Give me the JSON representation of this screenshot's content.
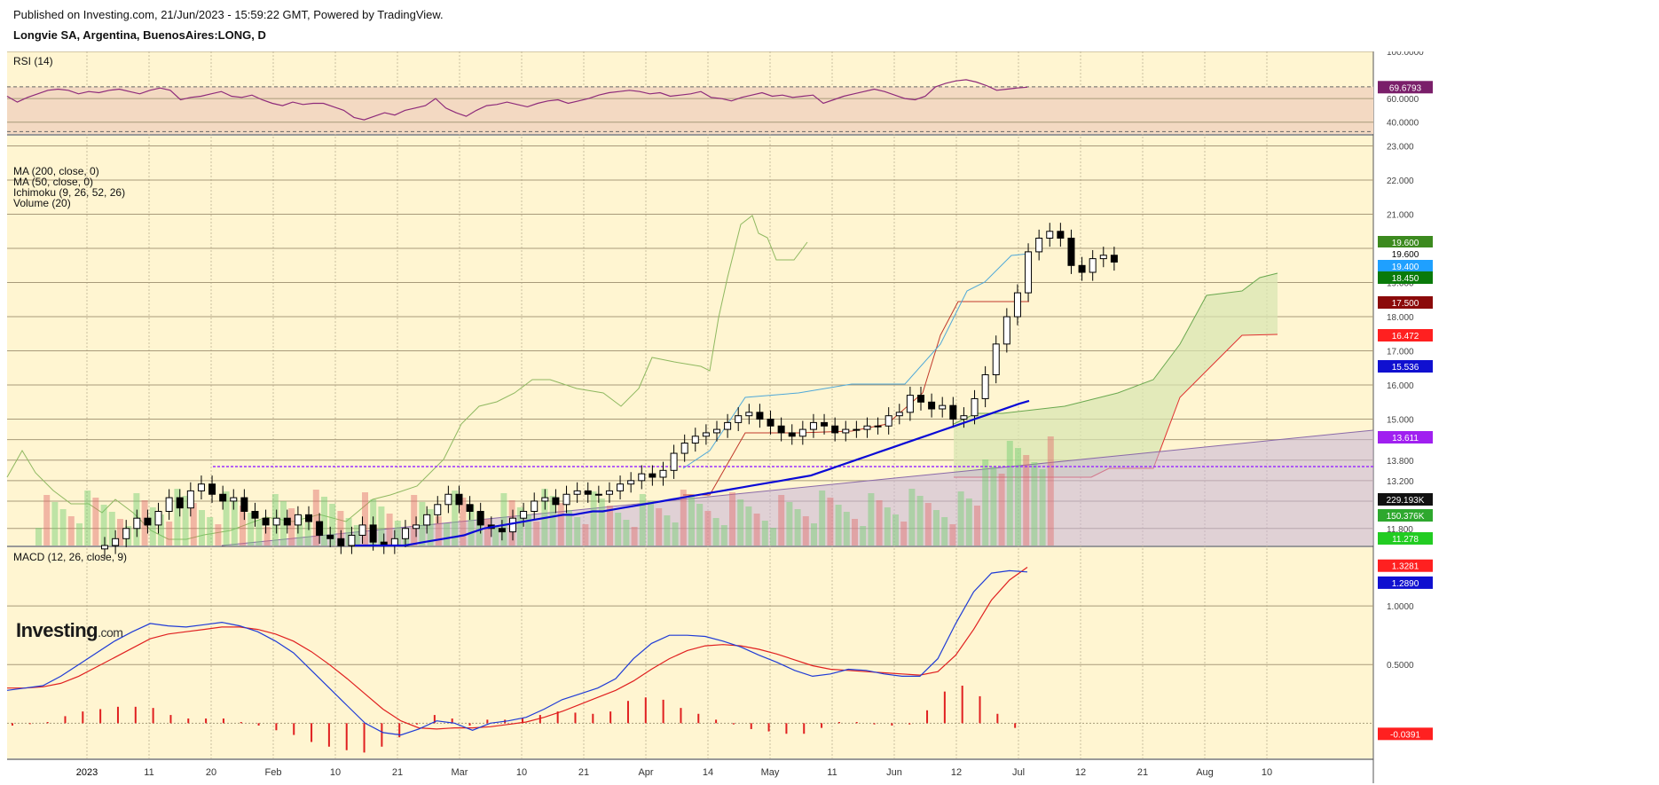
{
  "header": {
    "published": "Published on Investing.com, 21/Jun/2023 - 15:59:22 GMT, Powered by TradingView.",
    "symbol": "Longvie SA, Argentina, BuenosAires:LONG, D"
  },
  "logo": {
    "main": "Investing",
    "suffix": ".com"
  },
  "colors": {
    "background": "#fff5d1",
    "rsi_band": "#f3d9c2",
    "rsi_line": "#8e2b7a",
    "ma200": "#0a0ad6",
    "ma50": "#c0392b",
    "kumo_green": "#6aa84f",
    "kumo_red": "#e03030",
    "macd_line": "#1f3bd6",
    "signal_line": "#e02020",
    "hist": "#e02020",
    "trend": "#9b30ff"
  },
  "chart_data": [
    {
      "type": "line",
      "panel": "rsi",
      "title": "RSI (14)",
      "ylim": [
        30,
        100
      ],
      "yticks": [
        40,
        60,
        100
      ],
      "ytick_labels": [
        "40.0000",
        "60.0000",
        "100.0000"
      ],
      "band": [
        30,
        70
      ],
      "series": [
        {
          "last_label": "69.6793",
          "values": [
            62,
            57,
            61,
            64,
            67,
            68,
            67,
            64,
            66,
            65,
            67,
            68,
            66,
            64,
            67,
            69,
            67,
            59,
            61,
            62,
            64,
            66,
            62,
            61,
            63,
            59,
            56,
            54,
            57,
            55,
            56,
            56,
            53,
            50,
            44,
            42,
            45,
            48,
            46,
            50,
            52,
            54,
            60,
            52,
            48,
            45,
            50,
            54,
            55,
            57,
            55,
            53,
            56,
            58,
            59,
            56,
            58,
            60,
            63,
            65,
            66,
            67,
            66,
            64,
            65,
            62,
            63,
            64,
            66,
            61,
            60,
            58,
            61,
            63,
            65,
            62,
            63,
            61,
            62,
            63,
            56,
            59,
            62,
            64,
            66,
            68,
            66,
            63,
            60,
            59,
            62,
            70,
            73,
            75,
            76,
            74,
            71,
            67,
            68,
            69,
            69.68
          ]
        }
      ]
    },
    {
      "type": "candlestick",
      "panel": "price",
      "legend": [
        "MA (200, close, 0)",
        "MA (50, close, 0)",
        "Ichimoku (9, 26, 52, 26)",
        "Volume (20)"
      ],
      "ylim": [
        11.3,
        23.3
      ],
      "yticks": [
        11.8,
        12.6,
        13.2,
        13.8,
        14.4,
        15.0,
        16.0,
        17.0,
        18.0,
        19.0,
        20.0,
        21.0,
        22.0,
        23.0
      ],
      "ytick_labels": [
        "11.800",
        "12.600",
        "13.200",
        "13.800",
        "14.400",
        "15.000",
        "16.000",
        "17.000",
        "18.000",
        "19.000",
        "20.000",
        "21.000",
        "22.000",
        "23.000"
      ],
      "x_labels": [
        "2023",
        "11",
        "20",
        "Feb",
        "10",
        "21",
        "Mar",
        "10",
        "21",
        "Apr",
        "14",
        "May",
        "11",
        "Jun",
        "12",
        "Jul",
        "12",
        "21",
        "Aug",
        "10"
      ],
      "x_label_index": [
        0,
        10,
        20,
        30,
        40,
        50,
        60,
        70,
        80,
        90,
        100,
        110,
        120,
        130,
        140,
        150,
        160,
        170,
        180,
        190
      ],
      "close": [
        11.3,
        11.5,
        11.8,
        12.1,
        11.9,
        12.3,
        12.7,
        12.4,
        12.9,
        13.1,
        12.8,
        12.6,
        12.7,
        12.3,
        12.1,
        11.9,
        12.1,
        11.9,
        12.2,
        12.0,
        11.6,
        11.5,
        11.3,
        11.6,
        11.9,
        11.4,
        11.3,
        11.5,
        11.8,
        11.9,
        12.2,
        12.5,
        12.8,
        12.5,
        12.3,
        11.9,
        11.8,
        11.7,
        12.1,
        12.3,
        12.6,
        12.7,
        12.5,
        12.8,
        12.9,
        12.8,
        12.8,
        12.9,
        13.1,
        13.2,
        13.4,
        13.3,
        13.5,
        14.0,
        14.3,
        14.5,
        14.6,
        14.7,
        14.9,
        15.1,
        15.2,
        15.0,
        14.8,
        14.6,
        14.5,
        14.7,
        14.9,
        14.8,
        14.6,
        14.7,
        14.7,
        14.8,
        14.8,
        15.1,
        15.2,
        15.7,
        15.5,
        15.3,
        15.4,
        15.0,
        15.1,
        15.6,
        16.3,
        17.2,
        18.0,
        18.7,
        19.9,
        20.3,
        20.5,
        20.3,
        19.5,
        19.3,
        19.7,
        19.8,
        19.6
      ],
      "ma50": [
        11.3,
        11.3,
        11.3,
        11.3,
        11.3,
        11.3,
        11.35,
        11.4,
        11.45,
        11.5,
        11.55,
        11.6,
        11.7,
        11.8,
        11.85,
        11.9,
        11.95,
        12.0,
        12.05,
        12.1,
        12.15,
        12.2,
        12.2,
        12.25,
        12.3,
        12.3,
        12.35,
        12.4,
        12.45,
        12.5,
        12.55,
        12.6,
        12.65,
        12.7,
        12.75,
        12.8,
        12.85,
        12.9,
        12.95,
        13.0,
        13.05,
        13.1,
        13.15,
        13.2,
        13.25,
        13.3,
        13.35,
        13.45,
        13.55,
        13.65,
        13.75,
        13.85,
        13.95,
        14.05,
        14.15,
        14.25,
        14.35,
        14.45,
        14.55,
        14.65,
        14.75,
        14.85,
        14.95,
        15.05,
        15.15,
        15.25,
        15.35,
        15.45,
        15.536
      ],
      "values_last": {
        "ma200_visible": false
      },
      "trend_level": 13.611,
      "price_labels": [
        {
          "text": "19.600",
          "color": "#3c8a1f"
        },
        {
          "text": "19.600",
          "color": "#ffffff"
        },
        {
          "text": "19.400",
          "color": "#1fa0ff"
        },
        {
          "text": "18.450",
          "color": "#0a7a0a"
        },
        {
          "text": "17.500",
          "color": "#8b0a0a"
        },
        {
          "text": "16.472",
          "color": "#ff2020"
        },
        {
          "text": "15.536",
          "color": "#1010d0"
        },
        {
          "text": "13.611",
          "color": "#a020f0"
        },
        {
          "text": "229.193K",
          "color": "#111111"
        },
        {
          "text": "150.376K",
          "color": "#2ea82e"
        },
        {
          "text": "11.278",
          "color": "#22cc22"
        }
      ]
    },
    {
      "type": "line",
      "panel": "macd",
      "title": "MACD (12, 26, close, 9)",
      "ylim": [
        -0.3,
        1.5
      ],
      "yticks": [
        0.5,
        1.0
      ],
      "ytick_labels": [
        "0.5000",
        "1.0000"
      ],
      "series": [
        {
          "name": "MACD",
          "last_label": "1.2890",
          "values": [
            0.28,
            0.3,
            0.32,
            0.4,
            0.5,
            0.6,
            0.7,
            0.78,
            0.85,
            0.83,
            0.82,
            0.84,
            0.86,
            0.83,
            0.78,
            0.7,
            0.6,
            0.45,
            0.3,
            0.15,
            0.0,
            -0.08,
            -0.1,
            -0.05,
            0.02,
            0.0,
            -0.06,
            0.0,
            0.02,
            0.05,
            0.12,
            0.2,
            0.25,
            0.3,
            0.38,
            0.55,
            0.68,
            0.75,
            0.75,
            0.74,
            0.7,
            0.65,
            0.58,
            0.52,
            0.45,
            0.4,
            0.42,
            0.46,
            0.45,
            0.42,
            0.4,
            0.4,
            0.55,
            0.85,
            1.12,
            1.28,
            1.3,
            1.29
          ]
        },
        {
          "name": "Signal",
          "last_label": "1.3281",
          "values": [
            0.3,
            0.3,
            0.31,
            0.34,
            0.4,
            0.48,
            0.56,
            0.64,
            0.72,
            0.76,
            0.78,
            0.8,
            0.82,
            0.82,
            0.8,
            0.76,
            0.7,
            0.61,
            0.5,
            0.38,
            0.25,
            0.12,
            0.02,
            -0.04,
            -0.05,
            -0.04,
            -0.04,
            -0.03,
            -0.01,
            0.01,
            0.05,
            0.1,
            0.16,
            0.22,
            0.28,
            0.36,
            0.46,
            0.55,
            0.62,
            0.66,
            0.67,
            0.66,
            0.63,
            0.59,
            0.54,
            0.49,
            0.46,
            0.45,
            0.44,
            0.43,
            0.42,
            0.41,
            0.44,
            0.58,
            0.8,
            1.05,
            1.22,
            1.33
          ]
        },
        {
          "name": "Histogram",
          "last_label": "-0.0391",
          "values": [
            -0.02,
            0.0,
            0.01,
            0.06,
            0.1,
            0.12,
            0.14,
            0.14,
            0.13,
            0.07,
            0.04,
            0.04,
            0.04,
            0.01,
            -0.02,
            -0.06,
            -0.1,
            -0.16,
            -0.2,
            -0.23,
            -0.25,
            -0.2,
            -0.12,
            -0.01,
            0.07,
            0.04,
            -0.02,
            0.03,
            0.03,
            0.04,
            0.07,
            0.1,
            0.09,
            0.08,
            0.1,
            0.19,
            0.22,
            0.2,
            0.13,
            0.08,
            0.03,
            -0.01,
            -0.05,
            -0.07,
            -0.09,
            -0.09,
            -0.04,
            0.01,
            0.01,
            -0.01,
            -0.02,
            -0.01,
            0.11,
            0.27,
            0.32,
            0.23,
            0.08,
            -0.04
          ]
        }
      ]
    }
  ]
}
